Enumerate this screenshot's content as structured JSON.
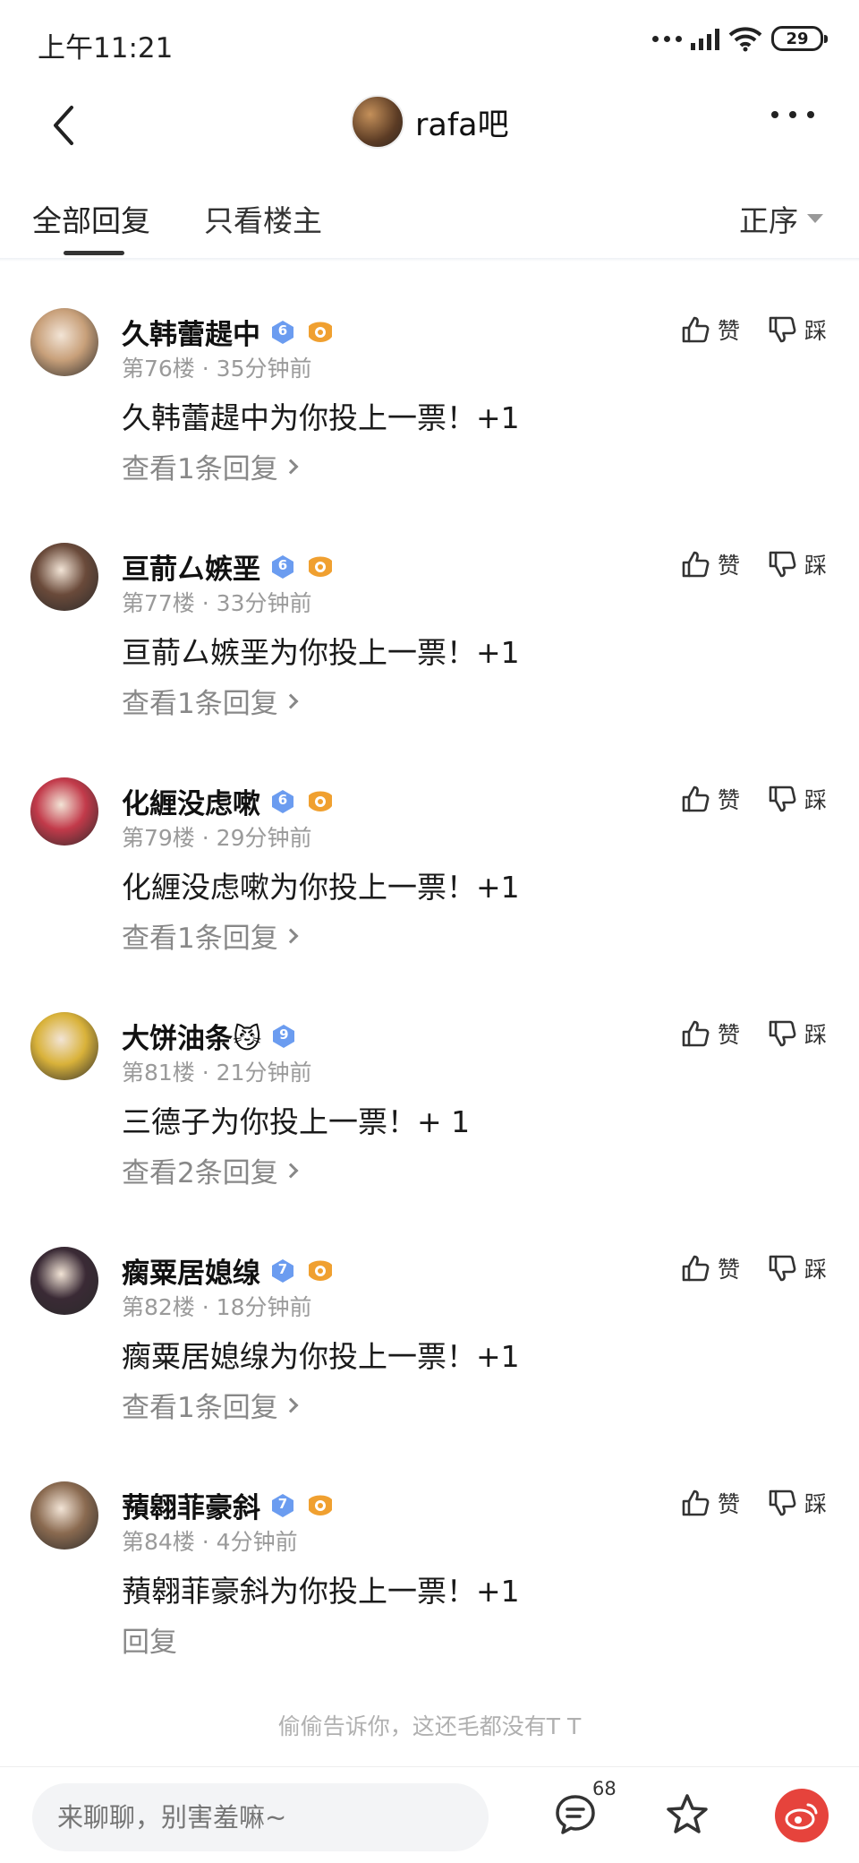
{
  "status_bar": {
    "time": "上午11:21",
    "battery": "29"
  },
  "header": {
    "title": "rafa吧"
  },
  "tabs": {
    "all": "全部回复",
    "owner_only": "只看楼主",
    "sort": "正序"
  },
  "actions": {
    "like": "赞",
    "dislike": "踩"
  },
  "posts": [
    {
      "username": "久韩蕾趧中",
      "level": "6",
      "floor": "第76楼",
      "time": "35分钟前",
      "content": "久韩蕾趧中为你投上一票！+1",
      "replies": "查看1条回复",
      "has_fan_badge": true,
      "avatar_color": "#c8a07a"
    },
    {
      "username": "亘葥厶嫉垩",
      "level": "6",
      "floor": "第77楼",
      "time": "33分钟前",
      "content": "亘葥厶嫉垩为你投上一票！+1",
      "replies": "查看1条回复",
      "has_fan_badge": true,
      "avatar_color": "#6a4a3a"
    },
    {
      "username": "化緾没虑嗽",
      "level": "6",
      "floor": "第79楼",
      "time": "29分钟前",
      "content": "化緾没虑嗽为你投上一票！+1",
      "replies": "查看1条回复",
      "has_fan_badge": true,
      "avatar_color": "#c23a4a"
    },
    {
      "username": "大饼油条😼",
      "level": "9",
      "floor": "第81楼",
      "time": "21分钟前",
      "content": "三德子为你投上一票！+ 1",
      "replies": "查看2条回复",
      "has_fan_badge": false,
      "avatar_color": "#d9b23a"
    },
    {
      "username": "瘸粟居媳缐",
      "level": "7",
      "floor": "第82楼",
      "time": "18分钟前",
      "content": "瘸粟居媳缐为你投上一票！+1",
      "replies": "查看1条回复",
      "has_fan_badge": true,
      "avatar_color": "#3a2a35"
    },
    {
      "username": "蕷翱菲豪斜",
      "level": "7",
      "floor": "第84楼",
      "time": "4分钟前",
      "content": "蕷翱菲豪斜为你投上一票！+1",
      "replies": "回复",
      "has_fan_badge": true,
      "avatar_color": "#8a6a50"
    }
  ],
  "footer_hint": "偷偷告诉你，这还毛都没有T T",
  "bottom_bar": {
    "input_placeholder": "来聊聊，别害羞嘛~",
    "comment_count": "68"
  },
  "colors": {
    "level_badge": "#6b9cf0",
    "fan_badge": "#f0a030",
    "weibo": "#e6433c"
  }
}
